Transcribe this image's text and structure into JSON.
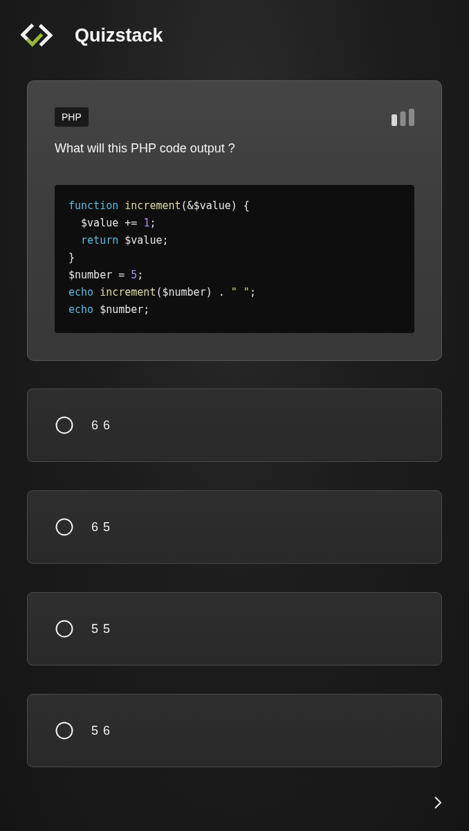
{
  "app": {
    "name": "Quizstack"
  },
  "question": {
    "tag": "PHP",
    "difficulty": {
      "level": 0.33
    },
    "text": "What will this PHP code output ?",
    "code": [
      {
        "tokens": [
          {
            "kind": "keyword",
            "text": "function"
          },
          {
            "kind": "function",
            "text": " increment"
          },
          {
            "kind": "plain",
            "text": "(&$value) {"
          }
        ]
      },
      {
        "tokens": [
          {
            "kind": "plain",
            "text": "  $value += "
          },
          {
            "kind": "number",
            "text": "1"
          },
          {
            "kind": "plain",
            "text": ";"
          }
        ]
      },
      {
        "tokens": [
          {
            "kind": "keyword",
            "text": "  return"
          },
          {
            "kind": "plain",
            "text": " $value;"
          }
        ]
      },
      {
        "tokens": [
          {
            "kind": "plain",
            "text": "}"
          }
        ]
      },
      {
        "tokens": [
          {
            "kind": "plain",
            "text": "$number = "
          },
          {
            "kind": "number",
            "text": "5"
          },
          {
            "kind": "plain",
            "text": ";"
          }
        ]
      },
      {
        "tokens": [
          {
            "kind": "keyword",
            "text": "echo"
          },
          {
            "kind": "function",
            "text": " increment"
          },
          {
            "kind": "plain",
            "text": "($number) . "
          },
          {
            "kind": "string",
            "text": "\" \""
          },
          {
            "kind": "plain",
            "text": ";"
          }
        ]
      },
      {
        "tokens": [
          {
            "kind": "keyword",
            "text": "echo"
          },
          {
            "kind": "plain",
            "text": " $number;"
          }
        ]
      }
    ]
  },
  "options": [
    {
      "label": "6 6",
      "selected": false
    },
    {
      "label": "6 5",
      "selected": false
    },
    {
      "label": "5 5",
      "selected": false
    },
    {
      "label": "5 6",
      "selected": false
    }
  ]
}
